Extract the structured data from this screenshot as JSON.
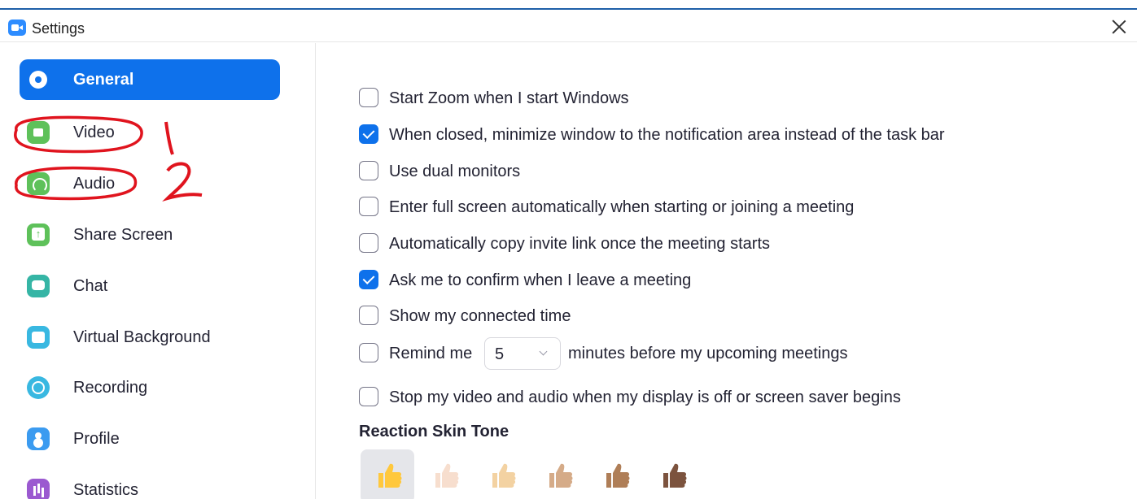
{
  "window": {
    "title": "Settings"
  },
  "sidebar": {
    "items": [
      {
        "label": "General",
        "icon": "gear-icon",
        "active": true
      },
      {
        "label": "Video",
        "icon": "video-camera-icon",
        "active": false
      },
      {
        "label": "Audio",
        "icon": "headphones-icon",
        "active": false
      },
      {
        "label": "Share Screen",
        "icon": "share-screen-icon",
        "active": false
      },
      {
        "label": "Chat",
        "icon": "chat-bubble-icon",
        "active": false
      },
      {
        "label": "Virtual Background",
        "icon": "virtual-background-icon",
        "active": false
      },
      {
        "label": "Recording",
        "icon": "recording-icon",
        "active": false
      },
      {
        "label": "Profile",
        "icon": "profile-icon",
        "active": false
      },
      {
        "label": "Statistics",
        "icon": "statistics-icon",
        "active": false
      }
    ]
  },
  "annotations": {
    "marks": [
      "1",
      "2"
    ]
  },
  "options": [
    {
      "label": "Start Zoom when I start Windows",
      "checked": false
    },
    {
      "label": "When closed, minimize window to the notification area instead of the task bar",
      "checked": true
    },
    {
      "label": "Use dual monitors",
      "checked": false
    },
    {
      "label": "Enter full screen automatically when starting or joining a meeting",
      "checked": false
    },
    {
      "label": "Automatically copy invite link once the meeting starts",
      "checked": false
    },
    {
      "label": "Ask me to confirm when I leave a meeting",
      "checked": true
    },
    {
      "label": "Show my connected time",
      "checked": false
    }
  ],
  "remind": {
    "checked": false,
    "prefix": "Remind me",
    "value": "5",
    "suffix": "minutes before my upcoming meetings"
  },
  "stop_video": {
    "label": "Stop my video and audio when my display is off or screen saver begins",
    "checked": false
  },
  "reaction": {
    "title": "Reaction Skin Tone",
    "tones": [
      {
        "name": "default-yellow",
        "color": "#FFC83D",
        "selected": true
      },
      {
        "name": "light",
        "color": "#F7DECE",
        "selected": false
      },
      {
        "name": "medium-light",
        "color": "#F3D2A2",
        "selected": false
      },
      {
        "name": "medium",
        "color": "#D5AB88",
        "selected": false
      },
      {
        "name": "medium-dark",
        "color": "#AF7E57",
        "selected": false
      },
      {
        "name": "dark",
        "color": "#7C533E",
        "selected": false
      }
    ]
  },
  "colors": {
    "accent": "#0E71EB",
    "annotation_red": "#E0141E"
  }
}
